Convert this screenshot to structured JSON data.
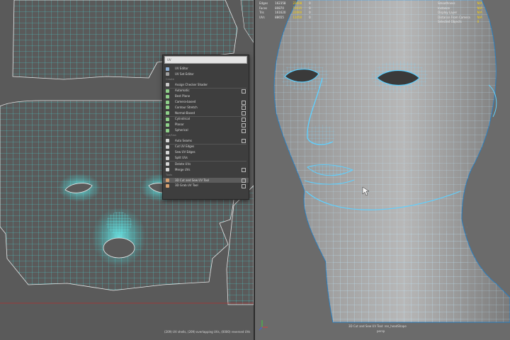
{
  "stats_left": {
    "rows": [
      {
        "label": "Edges",
        "a": "162358",
        "b": "22608",
        "c": "0"
      },
      {
        "label": "Faces",
        "a": "80870",
        "b": "11035",
        "c": "0"
      },
      {
        "label": "Tris",
        "a": "161620",
        "b": "22060",
        "c": "0"
      },
      {
        "label": "UVs",
        "a": "88655",
        "b": "11450",
        "c": "0"
      }
    ]
  },
  "stats_right": {
    "rows": [
      {
        "label": "Smoothness",
        "value": "N/A"
      },
      {
        "label": "Instance",
        "value": "N/A"
      },
      {
        "label": "Display Layer",
        "value": "N/A"
      },
      {
        "label": "Distance From Camera",
        "value": "N/A"
      },
      {
        "label": "Selected Objects",
        "value": "0"
      }
    ]
  },
  "menu": {
    "search_placeholder": "UV",
    "colors": {
      "bg": "#3e3e3e",
      "highlight": "#5c5c5c",
      "text": "#dedede",
      "section": "#8e8e8e"
    },
    "items": [
      {
        "type": "item",
        "label": "UV Editor",
        "icon": "uv-editor-icon",
        "color": "#8fb0d6",
        "box": false
      },
      {
        "type": "item",
        "label": "UV Set Editor",
        "icon": "uv-set-editor-icon",
        "color": "#a0a0a0",
        "box": false
      },
      {
        "type": "section",
        "label": "Create"
      },
      {
        "type": "item",
        "label": "Assign Checker Shader",
        "icon": "checker-icon",
        "color": "#c9c9c9",
        "box": false
      },
      {
        "type": "sep"
      },
      {
        "type": "item",
        "label": "Automatic",
        "icon": "automatic-map-icon",
        "color": "#8fd18a",
        "box": true
      },
      {
        "type": "item",
        "label": "Best Plane",
        "icon": "best-plane-icon",
        "color": "#8fd18a",
        "box": false
      },
      {
        "type": "item",
        "label": "Camera-based",
        "icon": "camera-based-icon",
        "color": "#8fd18a",
        "box": true
      },
      {
        "type": "item",
        "label": "Contour Stretch",
        "icon": "contour-stretch-icon",
        "color": "#8fd18a",
        "box": true
      },
      {
        "type": "item",
        "label": "Normal-Based",
        "icon": "normal-based-icon",
        "color": "#8fd18a",
        "box": true
      },
      {
        "type": "sep"
      },
      {
        "type": "item",
        "label": "Cylindrical",
        "icon": "cylindrical-icon",
        "color": "#8fd18a",
        "box": true
      },
      {
        "type": "item",
        "label": "Planar",
        "icon": "planar-icon",
        "color": "#8fd18a",
        "box": true
      },
      {
        "type": "item",
        "label": "Spherical",
        "icon": "spherical-icon",
        "color": "#8fd18a",
        "box": true
      },
      {
        "type": "section",
        "label": "Cut/Sew"
      },
      {
        "type": "item",
        "label": "Auto Seams",
        "icon": "auto-seams-icon",
        "color": "#d6d6d6",
        "box": true
      },
      {
        "type": "sep"
      },
      {
        "type": "item",
        "label": "Cut UV Edges",
        "icon": "cut-uv-icon",
        "color": "#d6d6d6",
        "box": false
      },
      {
        "type": "item",
        "label": "Sew UV Edges",
        "icon": "sew-uv-icon",
        "color": "#d6d6d6",
        "box": false
      },
      {
        "type": "item",
        "label": "Split UVs",
        "icon": "split-uv-icon",
        "color": "#d6d6d6",
        "box": false
      },
      {
        "type": "sep"
      },
      {
        "type": "item",
        "label": "Delete UVs",
        "icon": "delete-uv-icon",
        "color": "#d6d6d6",
        "box": false
      },
      {
        "type": "item",
        "label": "Merge UVs",
        "icon": "merge-uv-icon",
        "color": "#d6d6d6",
        "box": true
      },
      {
        "type": "section",
        "label": "Tools"
      },
      {
        "type": "item",
        "label": "3D Cut and Sew UV Tool",
        "icon": "cut-sew-tool-icon",
        "color": "#d6a070",
        "box": true,
        "highlight": true
      },
      {
        "type": "item",
        "label": "3D Grab UV Tool",
        "icon": "grab-uv-tool-icon",
        "color": "#d6a070",
        "box": true
      }
    ]
  },
  "uv_status": "(209) UV shells, (209) overlapping UVs, (0000) reversed UVs",
  "viewport_status": "3D Cut and Sew UV Tool: ren_headShape",
  "viewport_status_sub": "persp",
  "colors": {
    "wire": "#46e8e8",
    "viewport_wire": "#7fd7ff",
    "uv_bg": "#5a5a5a",
    "viewport_bg": "#6b6b6b"
  }
}
